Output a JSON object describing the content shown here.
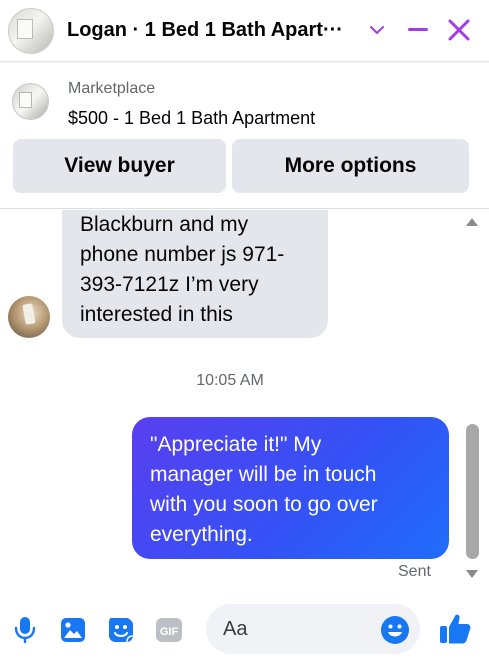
{
  "header": {
    "title": "Logan · 1 Bed 1 Bath Apart···",
    "accent_color": "#a33be8"
  },
  "listing": {
    "source": "Marketplace",
    "title": "$500 - 1 Bed 1 Bath Apartment",
    "view_buyer_label": "View buyer",
    "more_options_label": "More options"
  },
  "messages": {
    "incoming": {
      "lines": [
        "Blackburn and my",
        "phone number js 971-",
        "393-7121z I’m very",
        "interested in this"
      ]
    },
    "timestamp": "10:05 AM",
    "outgoing": {
      "lines": [
        "\"Appreciate it!\" My",
        "manager will be in touch",
        "with you soon to go over",
        "everything."
      ],
      "status": "Sent"
    }
  },
  "composer": {
    "placeholder": "Aa",
    "gif_label": "GIF",
    "icon_color": "#1877f2"
  }
}
